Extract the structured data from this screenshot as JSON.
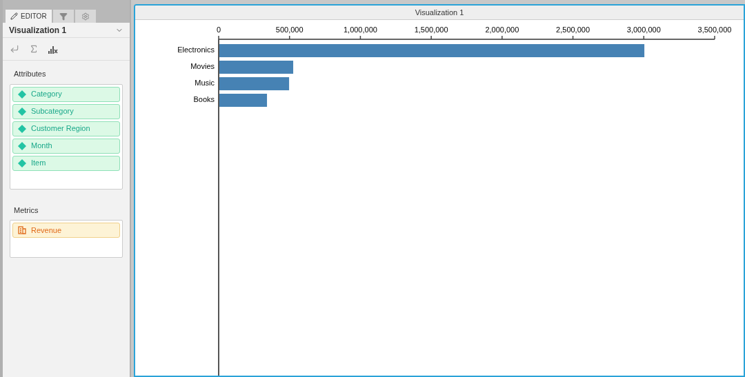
{
  "sidebar": {
    "tabs": [
      {
        "kind": "editor",
        "label": "EDITOR",
        "selected": true
      },
      {
        "kind": "filter",
        "selected": false
      },
      {
        "kind": "settings",
        "selected": false
      }
    ],
    "visualization_name": "Visualization 1",
    "sections": [
      {
        "title": "Attributes",
        "kind": "attribute",
        "items": [
          "Category",
          "Subcategory",
          "Customer Region",
          "Month",
          "Item"
        ]
      },
      {
        "title": "Metrics",
        "kind": "metric",
        "items": [
          "Revenue"
        ]
      }
    ]
  },
  "panel": {
    "title": "Visualization 1",
    "chart_data": {
      "type": "bar",
      "orientation": "horizontal",
      "categories": [
        "Electronics",
        "Movies",
        "Music",
        "Books"
      ],
      "series": [
        {
          "color": "#4682b4",
          "values": [
            3004000,
            526000,
            497000,
            341000
          ]
        }
      ],
      "xlim": [
        0,
        3500000
      ],
      "xticks": [
        {
          "value": 0,
          "label": "0"
        },
        {
          "value": 500000,
          "label": "500,000"
        },
        {
          "value": 1000000,
          "label": "1,000,000"
        },
        {
          "value": 1500000,
          "label": "1,500,000"
        },
        {
          "value": 2000000,
          "label": "2,000,000"
        },
        {
          "value": 2500000,
          "label": "2,500,000"
        },
        {
          "value": 3000000,
          "label": "3,000,000"
        },
        {
          "value": 3500000,
          "label": "3,500,000"
        }
      ]
    }
  }
}
